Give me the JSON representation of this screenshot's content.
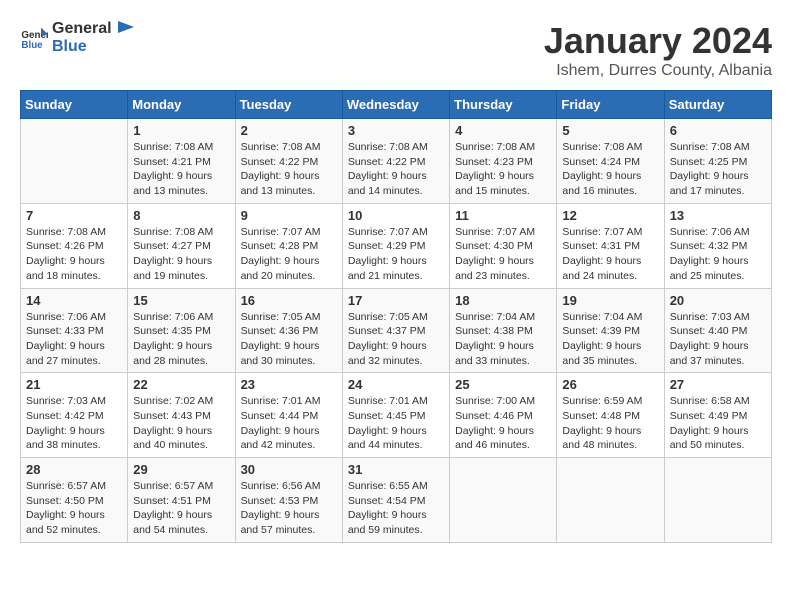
{
  "header": {
    "logo_general": "General",
    "logo_blue": "Blue",
    "month_title": "January 2024",
    "subtitle": "Ishem, Durres County, Albania"
  },
  "days_of_week": [
    "Sunday",
    "Monday",
    "Tuesday",
    "Wednesday",
    "Thursday",
    "Friday",
    "Saturday"
  ],
  "weeks": [
    [
      {
        "day": "",
        "content": ""
      },
      {
        "day": "1",
        "content": "Sunrise: 7:08 AM\nSunset: 4:21 PM\nDaylight: 9 hours\nand 13 minutes."
      },
      {
        "day": "2",
        "content": "Sunrise: 7:08 AM\nSunset: 4:22 PM\nDaylight: 9 hours\nand 13 minutes."
      },
      {
        "day": "3",
        "content": "Sunrise: 7:08 AM\nSunset: 4:22 PM\nDaylight: 9 hours\nand 14 minutes."
      },
      {
        "day": "4",
        "content": "Sunrise: 7:08 AM\nSunset: 4:23 PM\nDaylight: 9 hours\nand 15 minutes."
      },
      {
        "day": "5",
        "content": "Sunrise: 7:08 AM\nSunset: 4:24 PM\nDaylight: 9 hours\nand 16 minutes."
      },
      {
        "day": "6",
        "content": "Sunrise: 7:08 AM\nSunset: 4:25 PM\nDaylight: 9 hours\nand 17 minutes."
      }
    ],
    [
      {
        "day": "7",
        "content": "Sunrise: 7:08 AM\nSunset: 4:26 PM\nDaylight: 9 hours\nand 18 minutes."
      },
      {
        "day": "8",
        "content": "Sunrise: 7:08 AM\nSunset: 4:27 PM\nDaylight: 9 hours\nand 19 minutes."
      },
      {
        "day": "9",
        "content": "Sunrise: 7:07 AM\nSunset: 4:28 PM\nDaylight: 9 hours\nand 20 minutes."
      },
      {
        "day": "10",
        "content": "Sunrise: 7:07 AM\nSunset: 4:29 PM\nDaylight: 9 hours\nand 21 minutes."
      },
      {
        "day": "11",
        "content": "Sunrise: 7:07 AM\nSunset: 4:30 PM\nDaylight: 9 hours\nand 23 minutes."
      },
      {
        "day": "12",
        "content": "Sunrise: 7:07 AM\nSunset: 4:31 PM\nDaylight: 9 hours\nand 24 minutes."
      },
      {
        "day": "13",
        "content": "Sunrise: 7:06 AM\nSunset: 4:32 PM\nDaylight: 9 hours\nand 25 minutes."
      }
    ],
    [
      {
        "day": "14",
        "content": "Sunrise: 7:06 AM\nSunset: 4:33 PM\nDaylight: 9 hours\nand 27 minutes."
      },
      {
        "day": "15",
        "content": "Sunrise: 7:06 AM\nSunset: 4:35 PM\nDaylight: 9 hours\nand 28 minutes."
      },
      {
        "day": "16",
        "content": "Sunrise: 7:05 AM\nSunset: 4:36 PM\nDaylight: 9 hours\nand 30 minutes."
      },
      {
        "day": "17",
        "content": "Sunrise: 7:05 AM\nSunset: 4:37 PM\nDaylight: 9 hours\nand 32 minutes."
      },
      {
        "day": "18",
        "content": "Sunrise: 7:04 AM\nSunset: 4:38 PM\nDaylight: 9 hours\nand 33 minutes."
      },
      {
        "day": "19",
        "content": "Sunrise: 7:04 AM\nSunset: 4:39 PM\nDaylight: 9 hours\nand 35 minutes."
      },
      {
        "day": "20",
        "content": "Sunrise: 7:03 AM\nSunset: 4:40 PM\nDaylight: 9 hours\nand 37 minutes."
      }
    ],
    [
      {
        "day": "21",
        "content": "Sunrise: 7:03 AM\nSunset: 4:42 PM\nDaylight: 9 hours\nand 38 minutes."
      },
      {
        "day": "22",
        "content": "Sunrise: 7:02 AM\nSunset: 4:43 PM\nDaylight: 9 hours\nand 40 minutes."
      },
      {
        "day": "23",
        "content": "Sunrise: 7:01 AM\nSunset: 4:44 PM\nDaylight: 9 hours\nand 42 minutes."
      },
      {
        "day": "24",
        "content": "Sunrise: 7:01 AM\nSunset: 4:45 PM\nDaylight: 9 hours\nand 44 minutes."
      },
      {
        "day": "25",
        "content": "Sunrise: 7:00 AM\nSunset: 4:46 PM\nDaylight: 9 hours\nand 46 minutes."
      },
      {
        "day": "26",
        "content": "Sunrise: 6:59 AM\nSunset: 4:48 PM\nDaylight: 9 hours\nand 48 minutes."
      },
      {
        "day": "27",
        "content": "Sunrise: 6:58 AM\nSunset: 4:49 PM\nDaylight: 9 hours\nand 50 minutes."
      }
    ],
    [
      {
        "day": "28",
        "content": "Sunrise: 6:57 AM\nSunset: 4:50 PM\nDaylight: 9 hours\nand 52 minutes."
      },
      {
        "day": "29",
        "content": "Sunrise: 6:57 AM\nSunset: 4:51 PM\nDaylight: 9 hours\nand 54 minutes."
      },
      {
        "day": "30",
        "content": "Sunrise: 6:56 AM\nSunset: 4:53 PM\nDaylight: 9 hours\nand 57 minutes."
      },
      {
        "day": "31",
        "content": "Sunrise: 6:55 AM\nSunset: 4:54 PM\nDaylight: 9 hours\nand 59 minutes."
      },
      {
        "day": "",
        "content": ""
      },
      {
        "day": "",
        "content": ""
      },
      {
        "day": "",
        "content": ""
      }
    ]
  ]
}
